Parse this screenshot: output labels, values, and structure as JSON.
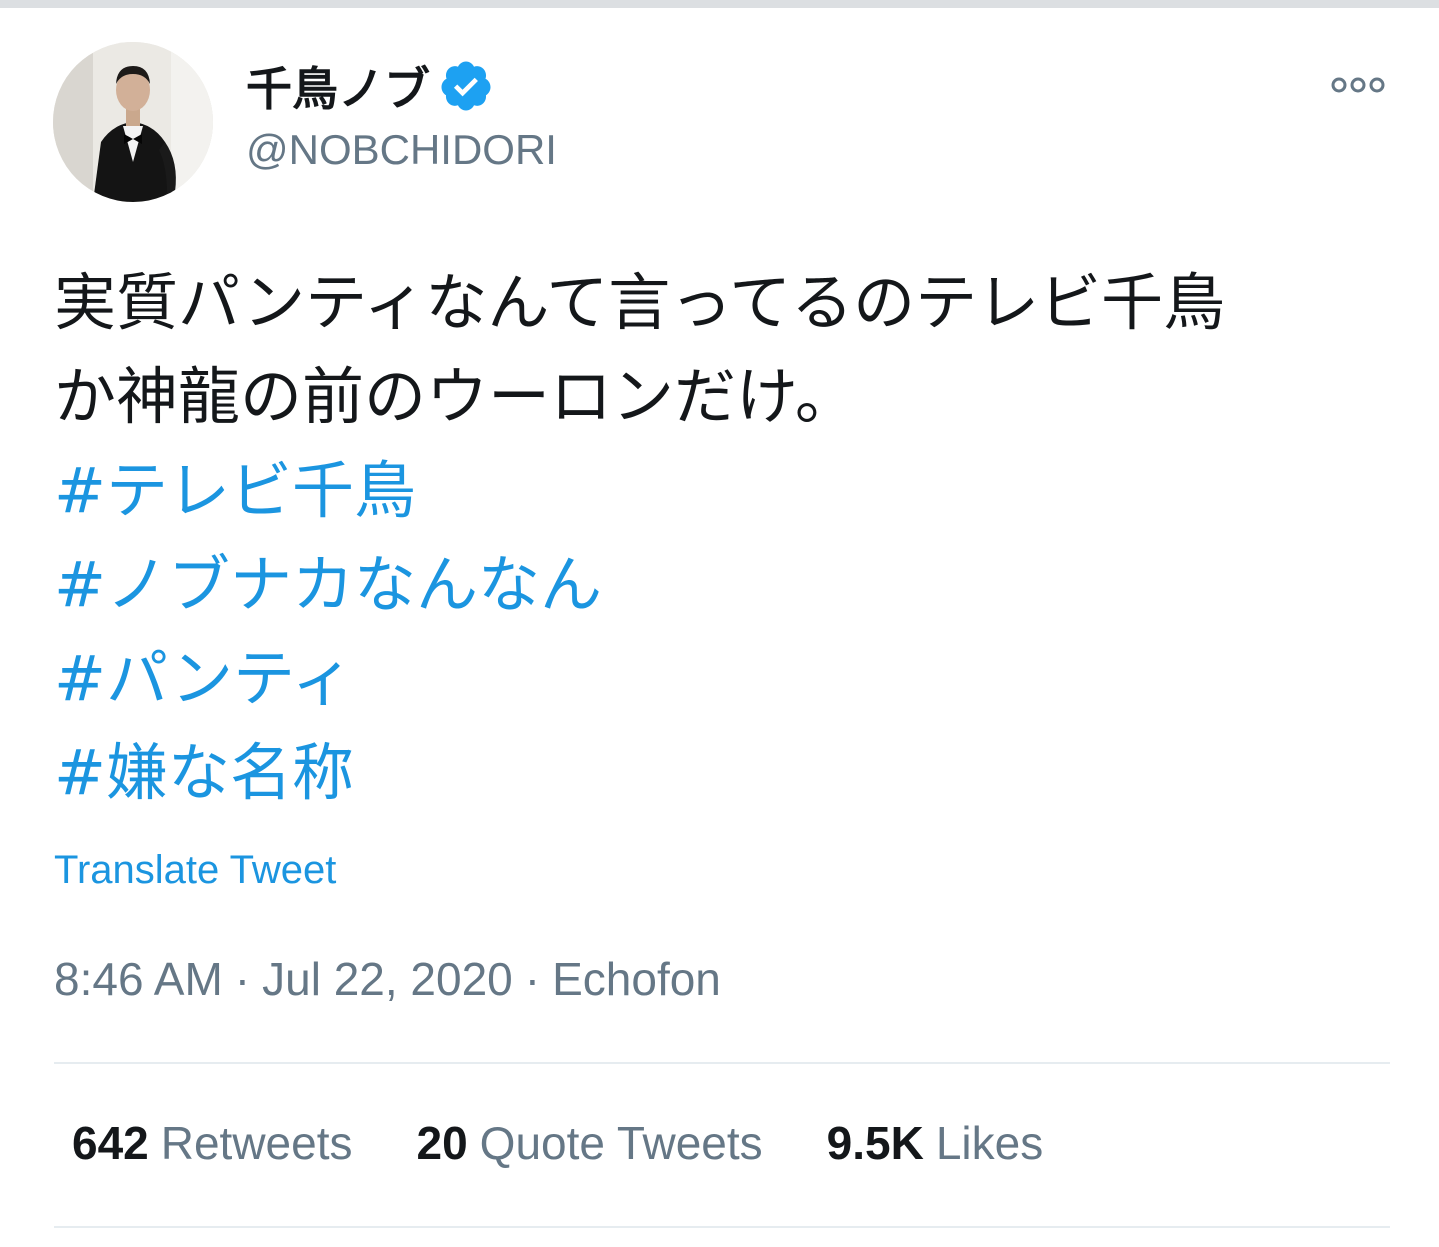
{
  "user": {
    "display_name": "千鳥ノブ",
    "handle": "@NOBCHIDORI",
    "verified": true,
    "avatar_icon": "avatar-photo"
  },
  "tweet": {
    "lines": [
      "実質パンティなんて言ってるのテレビ千鳥",
      "か神龍の前のウーロンだけ。"
    ],
    "hashtags": [
      "#テレビ千鳥",
      "#ノブナカなんなん",
      "#パンティ",
      "#嫌な名称"
    ],
    "translate_label": "Translate Tweet"
  },
  "meta": {
    "time": "8:46 AM",
    "date": "Jul 22, 2020",
    "source": "Echofon",
    "separator": "·"
  },
  "stats": [
    {
      "count": "642",
      "label": "Retweets"
    },
    {
      "count": "20",
      "label": "Quote Tweets"
    },
    {
      "count": "9.5K",
      "label": "Likes"
    }
  ],
  "colors": {
    "text": "#14171a",
    "secondary": "#657786",
    "link": "#1b95e0",
    "verified": "#1da1f2"
  }
}
